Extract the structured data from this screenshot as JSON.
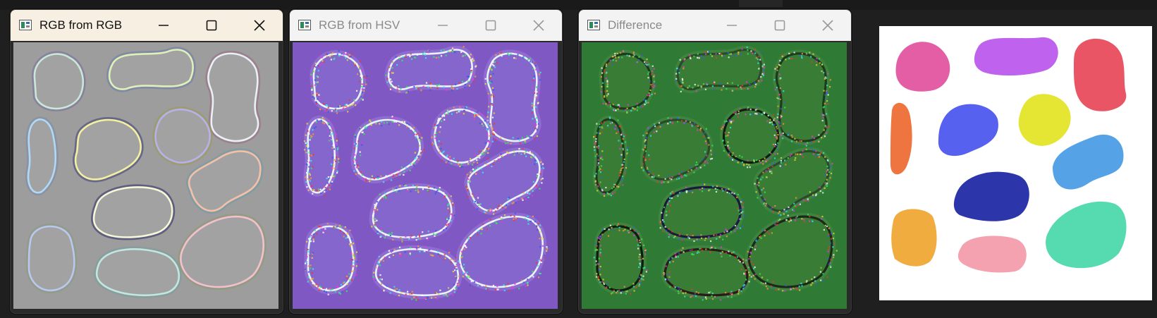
{
  "windows": [
    {
      "title": "RGB from RGB",
      "state": "active",
      "content_bg": "#9d9d9d",
      "blob_fill": "#a2a2a2"
    },
    {
      "title": "RGB from HSV",
      "state": "inactive",
      "content_bg": "#8058c4",
      "blob_fill": "#8566cc"
    },
    {
      "title": "Difference",
      "state": "inactive",
      "content_bg": "#2f7a34",
      "blob_fill": "#397c35"
    }
  ],
  "controls": {
    "minimize": "minimize-icon",
    "maximize": "maximize-icon",
    "close": "close-icon"
  },
  "window_icon": "app-window-icon",
  "thumbnail_colors": [
    "#e35ea5",
    "#bf62ee",
    "#ea5566",
    "#ee7440",
    "#5761f0",
    "#e5e533",
    "#55a3e6",
    "#2c35aa",
    "#f0ac3f",
    "#f4a1b0",
    "#55dbaf"
  ]
}
